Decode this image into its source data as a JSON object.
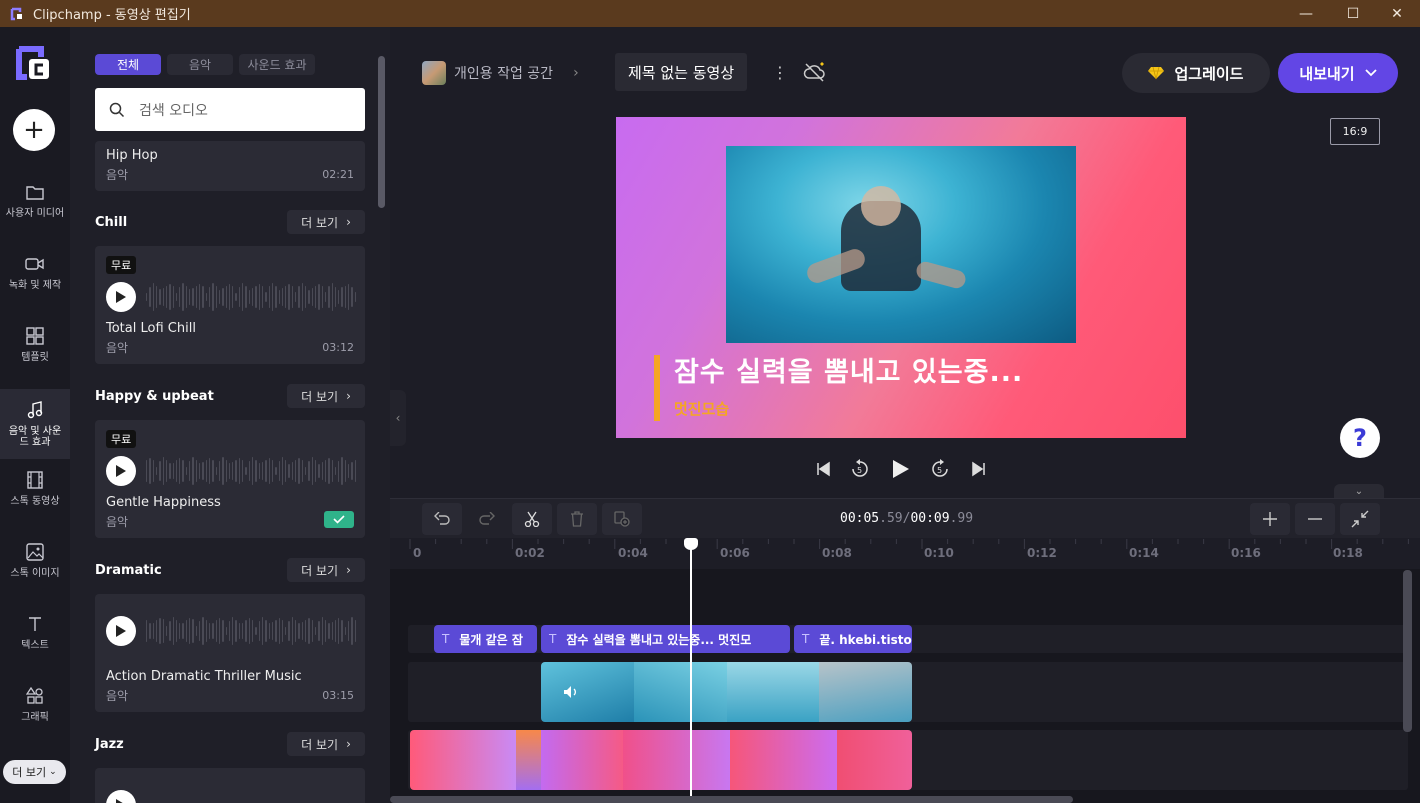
{
  "window": {
    "title": "Clipchamp - 동영상 편집기",
    "minimize": "—",
    "maximize": "☐",
    "close": "✕"
  },
  "rail": {
    "items": [
      {
        "label": "사용자 미디어",
        "icon": "folder-icon"
      },
      {
        "label": "녹화 및 제작",
        "icon": "camera-icon"
      },
      {
        "label": "템플릿",
        "icon": "template-icon"
      },
      {
        "label": "음악 및 사운드 효과",
        "icon": "music-note-icon"
      },
      {
        "label": "스톡 동영상",
        "icon": "film-icon"
      },
      {
        "label": "스톡 이미지",
        "icon": "image-icon"
      },
      {
        "label": "텍스트",
        "icon": "text-icon"
      },
      {
        "label": "그래픽",
        "icon": "shapes-icon"
      }
    ],
    "more": "더 보기"
  },
  "panel": {
    "tabs": [
      "전체",
      "음악",
      "사운드 효과"
    ],
    "search_placeholder": "검색 오디오",
    "see_more": "더 보기",
    "tracks": [
      {
        "title": "Hip Hop",
        "type": "음악",
        "duration": "02:21"
      },
      {
        "section": "Chill",
        "badge": "무료",
        "title": "Total Lofi Chill",
        "type": "음악",
        "duration": "03:12"
      },
      {
        "section": "Happy & upbeat",
        "badge": "무료",
        "title": "Gentle Happiness",
        "type": "음악",
        "added": true
      },
      {
        "section": "Dramatic",
        "title": "Action Dramatic Thriller Music",
        "type": "음악",
        "duration": "03:15"
      },
      {
        "section": "Jazz"
      }
    ]
  },
  "header": {
    "workspace": "개인용 작업 공간",
    "project_title": "제목 없는 동영상",
    "upgrade": "업그레이드",
    "export": "내보내기"
  },
  "preview": {
    "aspect_ratio": "16:9",
    "caption": "잠수 실력을 뽐내고 있는중...",
    "subcaption": "멋진모습",
    "colors": {
      "accent": "#f5a623",
      "gradient_start": "#c86bf0",
      "gradient_end": "#fd4f6c"
    }
  },
  "timeline": {
    "current": {
      "main": "00:05",
      "frac": ".59"
    },
    "total": {
      "main": "00:09",
      "frac": ".99"
    },
    "separator": "/",
    "ticks": [
      "0",
      "0:02",
      "0:04",
      "0:06",
      "0:08",
      "0:10",
      "0:12",
      "0:14",
      "0:16",
      "0:18"
    ],
    "text_clips": [
      "물개 같은 잠",
      "잠수 실력을 뽐내고 있는중... 멋진모",
      "끝. hkebi.tistory"
    ]
  }
}
